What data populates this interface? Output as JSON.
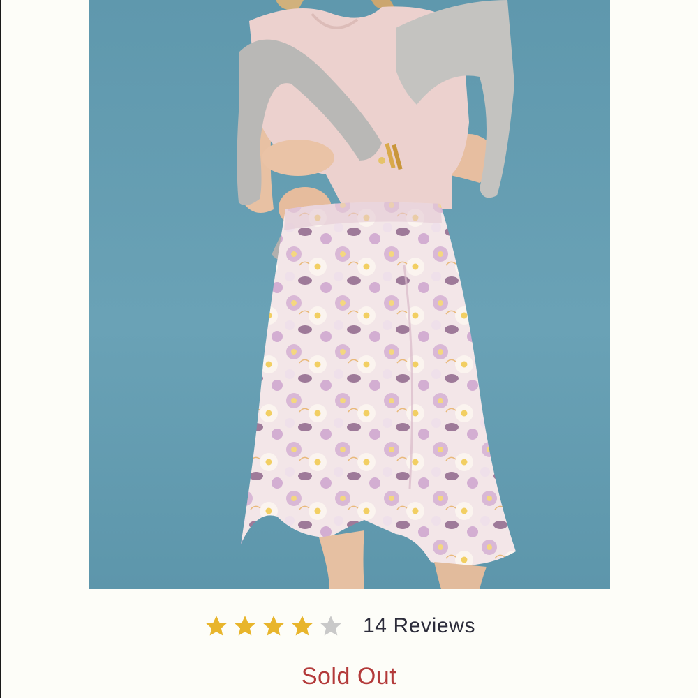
{
  "product": {
    "image_alt": "Floral ruffle wrap skirt",
    "rating": {
      "value": 4,
      "max": 5
    },
    "reviews_label": "14 Reviews",
    "status": "Sold Out"
  },
  "colors": {
    "background": "#fdfdf8",
    "image_backdrop": "#639cb1",
    "star_filled": "#e8b52c",
    "star_empty": "#c9c9c9",
    "status_text": "#b33a3a",
    "reviews_text": "#2c2c3a"
  },
  "icons": {
    "rating_star": "star-icon"
  }
}
